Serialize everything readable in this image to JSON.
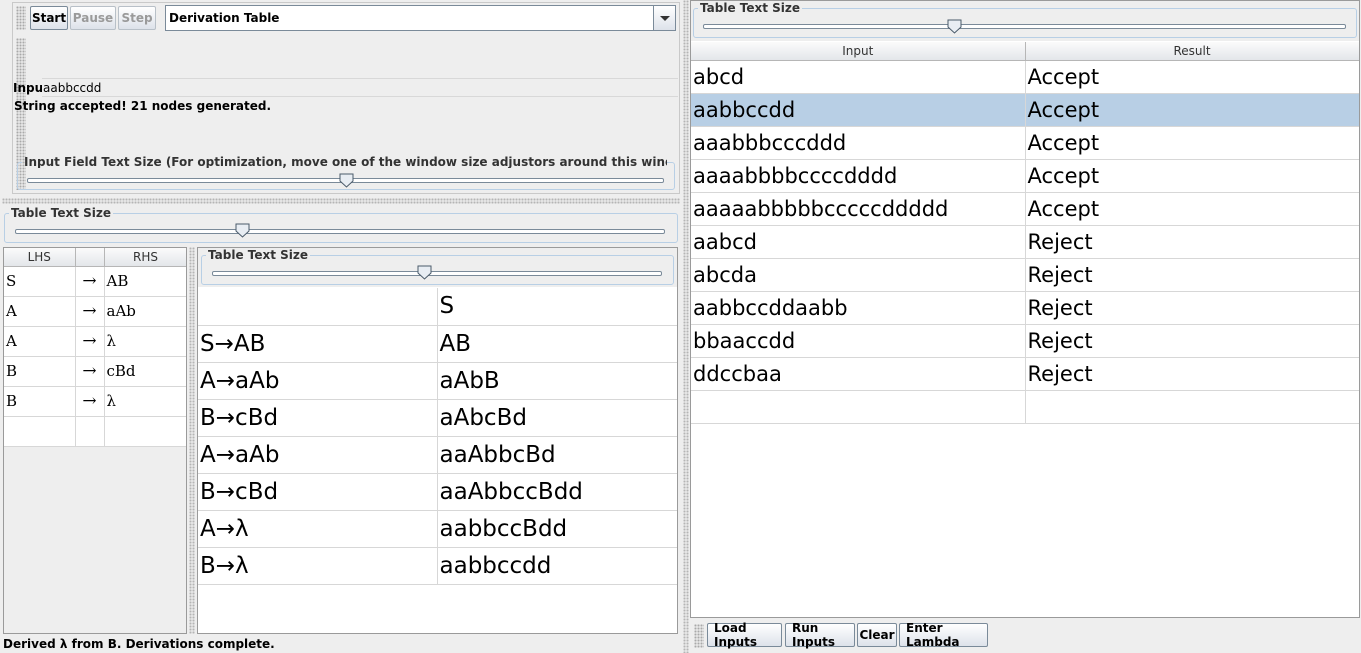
{
  "toolbar": {
    "start_label": "Start",
    "pause_label": "Pause",
    "step_label": "Step",
    "view_select_value": "Derivation Table"
  },
  "input_panel": {
    "input_label": "Input",
    "input_value": "aabbccdd",
    "status_message": "String accepted!  21 nodes generated.",
    "text_size_title": "Input Field Text Size (For optimization, move one of the window size adjustors around this window after resizing t...",
    "text_size_value": 0.5
  },
  "grammar_panel": {
    "text_size_title": "Table Text Size",
    "text_size_value": 0.35,
    "columns": [
      "LHS",
      "",
      "RHS"
    ],
    "arrow": "→",
    "rows": [
      {
        "lhs": "S",
        "rhs": "AB"
      },
      {
        "lhs": "A",
        "rhs": "aAb"
      },
      {
        "lhs": "A",
        "rhs": "λ"
      },
      {
        "lhs": "B",
        "rhs": "cBd"
      },
      {
        "lhs": "B",
        "rhs": "λ"
      }
    ]
  },
  "derivation_panel": {
    "text_size_title": "Table Text Size",
    "text_size_value": 0.47,
    "rows": [
      {
        "production": "",
        "derivation": "S"
      },
      {
        "production": "S→AB",
        "derivation": "AB"
      },
      {
        "production": "A→aAb",
        "derivation": "aAbB"
      },
      {
        "production": "B→cBd",
        "derivation": "aAbcBd"
      },
      {
        "production": "A→aAb",
        "derivation": "aaAbbcBd"
      },
      {
        "production": "B→cBd",
        "derivation": "aaAbbccBdd"
      },
      {
        "production": "A→λ",
        "derivation": "aabbccBdd"
      },
      {
        "production": "B→λ",
        "derivation": "aabbccdd"
      }
    ]
  },
  "multi_run_panel": {
    "text_size_title": "Table Text Size",
    "text_size_value": 0.39,
    "columns": [
      "Input",
      "Result"
    ],
    "selected_index": 1,
    "rows": [
      {
        "input": "abcd",
        "result": "Accept"
      },
      {
        "input": "aabbccdd",
        "result": "Accept"
      },
      {
        "input": "aaabbbcccddd",
        "result": "Accept"
      },
      {
        "input": "aaaabbbbccccdddd",
        "result": "Accept"
      },
      {
        "input": "aaaaabbbbbcccccddddd",
        "result": "Accept"
      },
      {
        "input": "aabcd",
        "result": "Reject"
      },
      {
        "input": "abcda",
        "result": "Reject"
      },
      {
        "input": "aabbccddaabb",
        "result": "Reject"
      },
      {
        "input": "bbaaccdd",
        "result": "Reject"
      },
      {
        "input": "ddccbaa",
        "result": "Reject"
      }
    ],
    "buttons": {
      "load_inputs": "Load Inputs",
      "run_inputs": "Run Inputs",
      "clear": "Clear",
      "enter_lambda": "Enter Lambda"
    }
  },
  "status_bar": {
    "message": "Derived λ from B.  Derivations complete."
  },
  "colors": {
    "background": "#eeeeee",
    "selection": "#b8cfe5",
    "panel_border": "#b8cfe5"
  }
}
